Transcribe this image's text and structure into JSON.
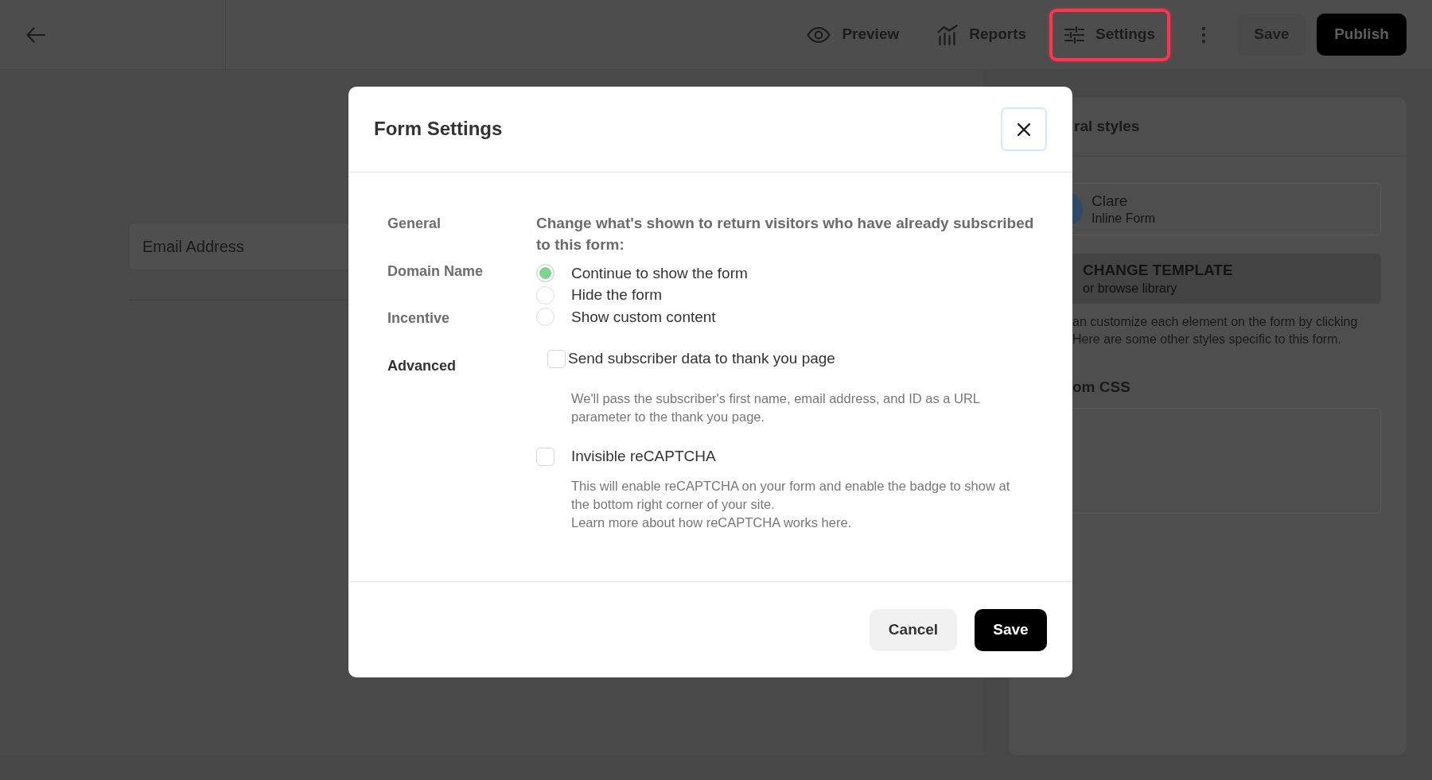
{
  "topbar": {
    "preview": {
      "label": "Preview",
      "highlighted": false
    },
    "reports": {
      "label": "Reports",
      "highlighted": false
    },
    "settings": {
      "label": "Settings",
      "highlighted": true
    },
    "save": "Save",
    "publish": "Publish"
  },
  "canvas": {
    "email_field": {
      "placeholder": "Email Address"
    }
  },
  "side_panel": {
    "heading": "ral styles",
    "template": {
      "name": "Clare",
      "type": "Inline Form"
    },
    "change_template": {
      "title": "CHANGE TEMPLATE",
      "subtitle": "or browse library"
    },
    "description": [
      "an customize each element on the form by clicking",
      "Here are some other styles specific to this form."
    ],
    "css_heading": "om CSS"
  },
  "modal": {
    "title": "Form Settings",
    "nav": [
      {
        "label": "General",
        "selected": false
      },
      {
        "label": "Domain Name",
        "selected": false
      },
      {
        "label": "Incentive",
        "selected": false
      },
      {
        "label": "Advanced",
        "selected": true
      }
    ],
    "intro": "Change what's shown to return visitors who have already subscribed to this form:",
    "return_visitor_options": [
      {
        "label": "Continue to show the form",
        "selected": true
      },
      {
        "label": "Hide the form",
        "selected": false
      },
      {
        "label": "Show custom content",
        "selected": false
      }
    ],
    "options": [
      {
        "label": "Send subscriber data to thank you page",
        "checked": false,
        "help": [
          "We'll pass the subscriber's first name, email address, and ID as a URL parameter to the thank you page."
        ]
      },
      {
        "label": "Invisible reCAPTCHA",
        "checked": false,
        "help": [
          "This will enable reCAPTCHA on your form and enable the badge to show at the bottom right corner of your site.",
          "Learn more about how reCAPTCHA works here."
        ]
      }
    ],
    "buttons": {
      "cancel": "Cancel",
      "save": "Save"
    }
  }
}
